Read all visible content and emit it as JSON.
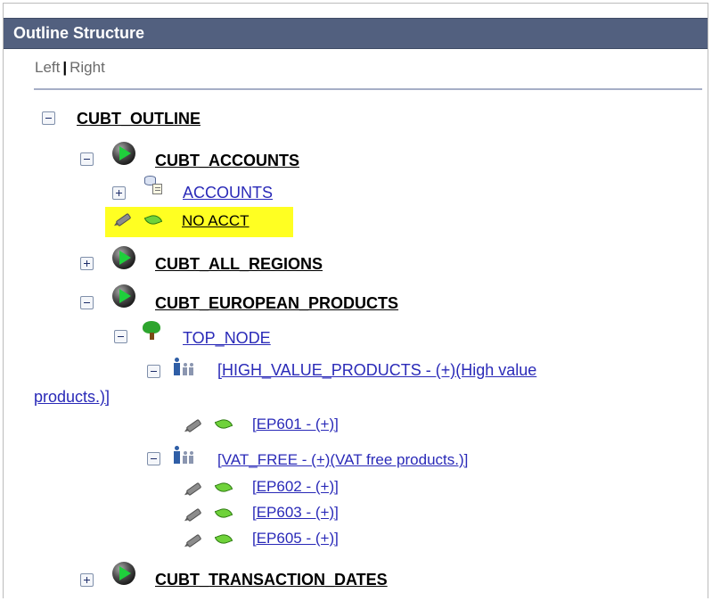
{
  "header": {
    "title": "Outline Structure"
  },
  "nav": {
    "left": "Left",
    "separator": "|",
    "right": "Right"
  },
  "tree": {
    "root": "CUBT_OUTLINE",
    "accounts": "CUBT_ACCOUNTS",
    "accounts_child": "ACCOUNTS",
    "no_acct": "NO ACCT",
    "all_regions": "CUBT_ALL_REGIONS",
    "european_products": "CUBT_EUROPEAN_PRODUCTS",
    "top_node": "TOP_NODE",
    "high_value_line1": "[HIGH_VALUE_PRODUCTS - (+)(High value",
    "high_value_line2": "products.)]",
    "ep601": "[EP601 - (+)]",
    "vat_free": "[VAT_FREE - (+)(VAT free products.)]",
    "ep602": "[EP602 - (+)]",
    "ep603": "[EP603 - (+)]",
    "ep605": "[EP605 - (+)]",
    "transaction_dates": "CUBT_TRANSACTION_DATES"
  },
  "colors": {
    "header_bg": "#52607f",
    "link": "#2a2ab8",
    "highlight": "#ffff22"
  }
}
